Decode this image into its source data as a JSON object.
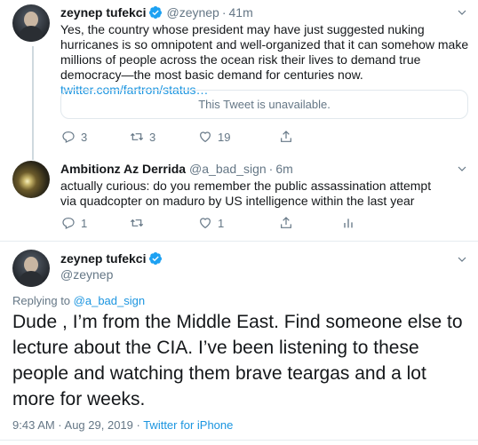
{
  "tweets": [
    {
      "name": "zeynep tufekci",
      "handle": "@zeynep",
      "time": "41m",
      "text": "Yes, the country whose president may have just suggested nuking hurricanes is so omnipotent and well-organized that it can somehow make millions of people across the ocean risk their lives to demand true democracy—the most basic demand for centuries now. ",
      "link": "twitter.com/fartron/status…",
      "quote_unavailable": "This Tweet is unavailable.",
      "replies": "3",
      "retweets": "3",
      "likes": "19"
    },
    {
      "name": "Ambitionz Az Derrida",
      "handle": "@a_bad_sign",
      "time": "6m",
      "text": "actually curious: do you remember the public assassination attempt via quadcopter on maduro by US intelligence within the last year",
      "replies": "1",
      "retweets": "",
      "likes": "1"
    }
  ],
  "main": {
    "name": "zeynep tufekci",
    "handle": "@zeynep",
    "replying_prefix": "Replying to ",
    "replying_to": "@a_bad_sign",
    "text": "Dude , I’m from the Middle East.   Find someone else to lecture about the CIA. I’ve been listening to these people and watching them brave teargas and a lot more for weeks.",
    "timestamp": "9:43 AM · Aug 29, 2019 · ",
    "source": "Twitter for iPhone"
  },
  "colors": {
    "accent": "#1b95e0",
    "verified": "#1da1f2",
    "muted": "#657786"
  },
  "icons": [
    "verified-icon",
    "caret-down-icon",
    "reply-icon",
    "retweet-icon",
    "like-icon",
    "share-icon",
    "analytics-icon"
  ]
}
